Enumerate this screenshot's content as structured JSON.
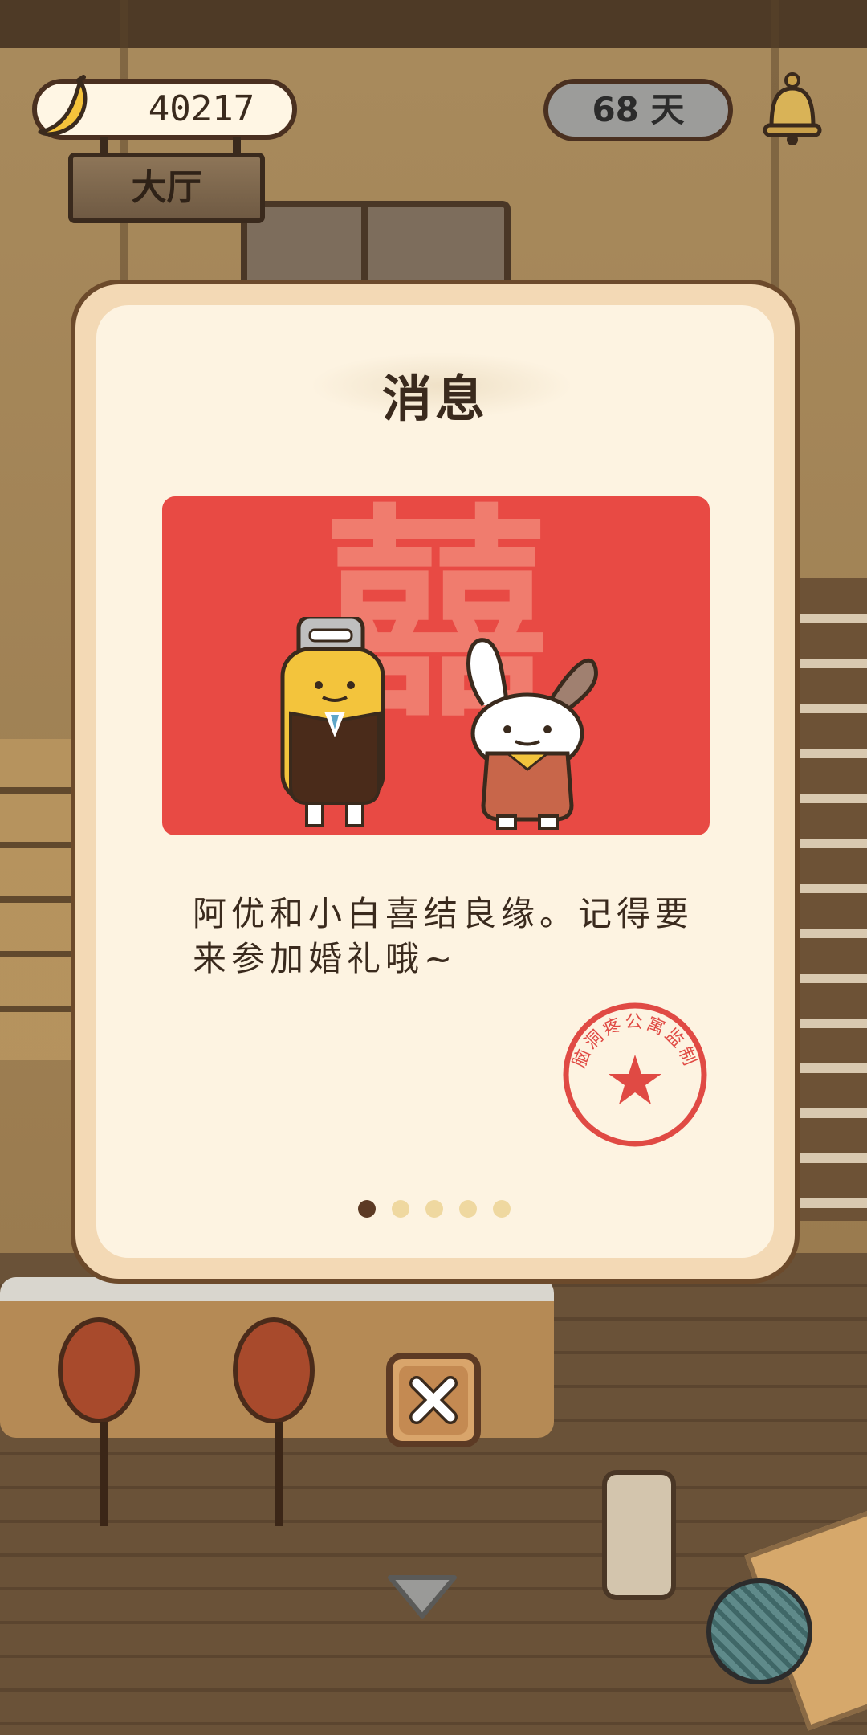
{
  "hud": {
    "banana_count": "40217",
    "location": "大厅",
    "days": "68 天"
  },
  "dialog": {
    "title": "消息",
    "card_char": "囍",
    "message": "阿优和小白喜结良缘。记得要来参加婚礼哦~",
    "stamp_text": "脑洞疼公寓监制",
    "page_count": 5,
    "current_page": 1
  },
  "colors": {
    "card_red": "#e84a44",
    "dialog_bg": "#fdf3e1",
    "stamp_red": "#e04a44"
  },
  "icons": [
    "banana-icon",
    "bell-icon",
    "close-icon",
    "chevron-down-icon",
    "yarn-ball-icon"
  ]
}
